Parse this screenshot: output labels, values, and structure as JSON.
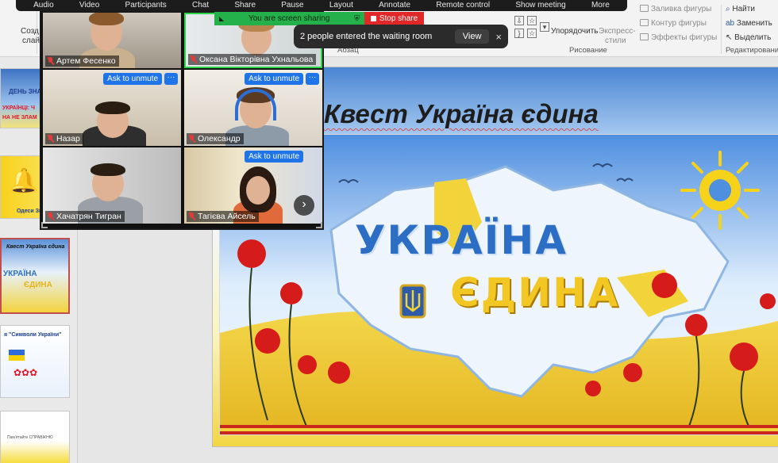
{
  "ribbon": {
    "create_label": "Созд",
    "slides_label": "слай",
    "paragraph_group": "Абзац",
    "drawing_group": "Рисование",
    "editing_group": "Редактирование",
    "arrange_label": "Упорядочить",
    "express_styles_label_1": "Экспресс-",
    "express_styles_label_2": "стили",
    "shape_fill": "Заливка фигуры",
    "shape_outline": "Контур фигуры",
    "shape_effects": "Эффекты фигуры",
    "find": "Найти",
    "replace": "Заменить",
    "select": "Выделить"
  },
  "zoom_toolbar": {
    "items": [
      "Audio",
      "Video",
      "Participants",
      "Chat",
      "Share",
      "Pause",
      "Layout",
      "Annotate",
      "Remote control",
      "Show meeting",
      "More"
    ]
  },
  "share_bar": {
    "status": "You are screen sharing",
    "stop": "Stop share"
  },
  "toast": {
    "message": "2 people entered the waiting room",
    "view": "View",
    "close": "×"
  },
  "gallery": {
    "ask_to_unmute": "Ask to unmute",
    "more": "···",
    "next": "›",
    "participants": [
      {
        "name": "Артем Фесенко"
      },
      {
        "name": "Оксана Вікторівна Ухнальова"
      },
      {
        "name": "Назар"
      },
      {
        "name": "Олександр"
      },
      {
        "name": "Хачатрян Тигран"
      },
      {
        "name": "Тагієва Айсель"
      }
    ]
  },
  "thumbnails": {
    "slide1_line1": "ДЕНЬ ЗНАН",
    "slide1_line2": "УКРАЇНЦІ: Ч",
    "slide1_line3": "НА НЕ ЗЛАМ",
    "slide2_text": "Одеси Зна",
    "slide3_line1": "Квест Україна єдина",
    "slide3_line2": "УКРАЇНА",
    "slide3_line3": "ЄДИНА",
    "slide4_text": "я \"Символи України\"",
    "slide5_text": "Пам'ятайте СПРАВЖНЮ"
  },
  "slide": {
    "title": "Квест Україна єдина",
    "poster_word_1": "УКРАЇНА",
    "poster_word_2": "ЄДИНА"
  }
}
